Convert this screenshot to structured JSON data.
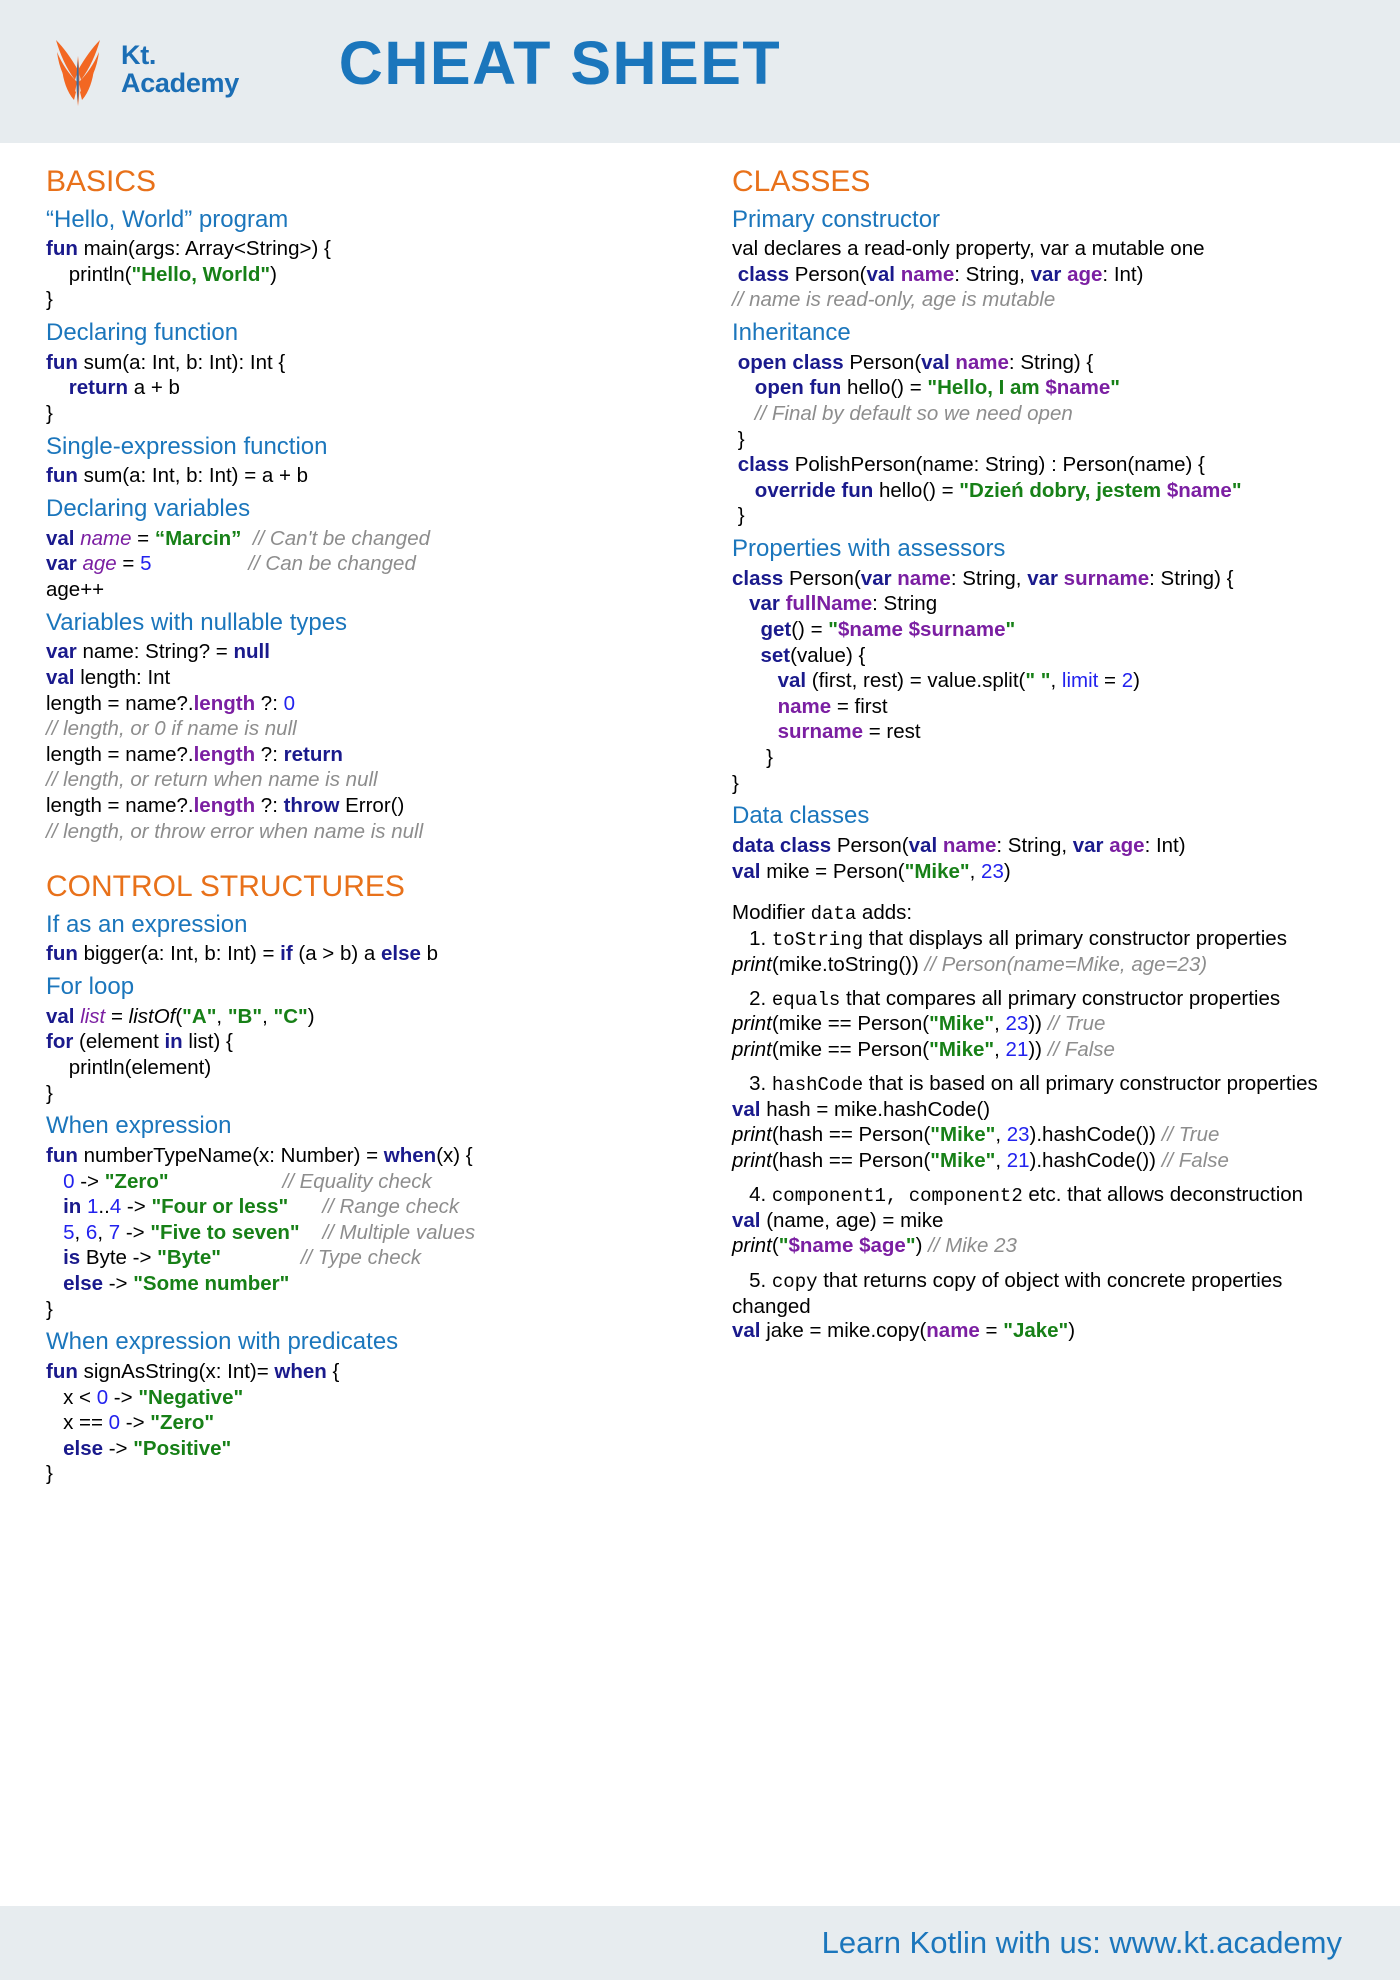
{
  "header": {
    "brand_line1": "Kt.",
    "brand_line2": "Academy",
    "title": "CHEAT SHEET",
    "logo_icon": "phoenix-logo"
  },
  "footer": {
    "text": "Learn Kotlin with us: www.kt.academy"
  },
  "colors": {
    "header_bg": "#e7ecef",
    "section_heading": "#e8711a",
    "sub_heading": "#1b76bc",
    "keyword": "#1a1a8c",
    "string": "#178017",
    "number": "#2222ee",
    "comment": "#8d8d8d",
    "property": "#7b1fa2",
    "brand_blue": "#1b6eb5"
  },
  "left_column": {
    "sections": [
      {
        "title": "BASICS",
        "blocks": [
          {
            "subtitle": "“Hello, World” program",
            "lines": [
              "fun main(args: Array<String>) {",
              "    println(\"Hello, World\")",
              "}"
            ]
          },
          {
            "subtitle": "Declaring function",
            "lines": [
              "fun sum(a: Int, b: Int): Int {",
              "    return a + b",
              "}"
            ]
          },
          {
            "subtitle": "Single-expression function",
            "lines": [
              "fun sum(a: Int, b: Int) = a + b"
            ]
          },
          {
            "subtitle": "Declaring variables",
            "lines": [
              "val name = “Marcin”   // Can't be changed",
              "var age = 5                    // Can be changed",
              "age++"
            ]
          },
          {
            "subtitle": "Variables with nullable types",
            "lines": [
              "var name: String? = null",
              "val length: Int",
              "length = name?.length ?: 0",
              "// length, or 0 if name is null",
              "length = name?.length ?: return",
              "// length, or return when name is null",
              "length = name?.length ?: throw Error()",
              "// length, or throw error when name is null"
            ]
          }
        ]
      },
      {
        "title": "CONTROL STRUCTURES",
        "blocks": [
          {
            "subtitle": "If as an expression",
            "lines": [
              "fun bigger(a: Int, b: Int) = if (a > b) a else b"
            ]
          },
          {
            "subtitle": "For loop",
            "lines": [
              "val list = listOf(\"A\", \"B\", \"C\")",
              "for (element in list) {",
              "    println(element)",
              "}"
            ]
          },
          {
            "subtitle": "When expression",
            "lines": [
              "fun numberTypeName(x: Number) = when(x) {",
              "   0 -> \"Zero\"                    // Equality check",
              "   in 1..4 -> \"Four or less\"      // Range check",
              "   5, 6, 7 -> \"Five to seven\"     // Multiple values",
              "   is Byte -> \"Byte\"              // Type check",
              "   else -> \"Some number\"",
              "}"
            ]
          },
          {
            "subtitle": "When expression with predicates",
            "lines": [
              "fun signAsString(x: Int)= when {",
              "   x < 0 -> \"Negative\"",
              "   x == 0 -> \"Zero\"",
              "   else -> \"Positive\"",
              "}"
            ]
          }
        ]
      }
    ]
  },
  "right_column": {
    "sections": [
      {
        "title": "CLASSES",
        "blocks": [
          {
            "subtitle": "Primary constructor",
            "lines": [
              "val declares a read-only property, var a mutable one",
              "class Person(val name: String, var age: Int)",
              "// name is read-only, age is mutable"
            ]
          },
          {
            "subtitle": "Inheritance",
            "lines": [
              "open class Person(val name: String) {",
              "    open fun hello() = \"Hello, I am $name\"",
              "    // Final by default so we need open",
              "}",
              "class PolishPerson(name: String) : Person(name) {",
              "    override fun hello() = \"Dzień dobry, jestem $name\"",
              "}"
            ]
          },
          {
            "subtitle": "Properties with assessors",
            "lines": [
              "class Person(var name: String, var surname: String) {",
              "    var fullName: String",
              "      get() = \"$name $surname\"",
              "      set(value) {",
              "         val (first, rest) = value.split(\" \", limit = 2)",
              "         name = first",
              "         surname = rest",
              "      }",
              "}"
            ]
          },
          {
            "subtitle": "Data classes",
            "lines": [
              "data class Person(val name: String, var age: Int)",
              "val mike = Person(\"Mike\", 23)"
            ]
          }
        ]
      }
    ],
    "modifier_intro": "Modifier data adds:",
    "modifier_keyword": "data",
    "modifier_items": [
      {
        "number": "1.",
        "mono": "toString",
        "text": " that displays all primary constructor properties",
        "examples": [
          "print(mike.toString()) // Person(name=Mike, age=23)"
        ]
      },
      {
        "number": "2.",
        "mono": "equals",
        "text": " that compares all primary constructor properties",
        "examples": [
          "print(mike == Person(\"Mike\", 23)) // True",
          "print(mike == Person(\"Mike\", 21)) // False"
        ]
      },
      {
        "number": "3.",
        "mono": "hashCode",
        "text": " that is based on all primary constructor properties",
        "examples": [
          "val hash = mike.hashCode()",
          "print(hash == Person(\"Mike\", 23).hashCode()) // True",
          "print(hash == Person(\"Mike\", 21).hashCode()) // False"
        ]
      },
      {
        "number": "4.",
        "mono": "component1, component2",
        "text": " etc. that allows deconstruction",
        "examples": [
          "val (name, age) = mike",
          "print(\"$name $age\") // Mike 23"
        ]
      },
      {
        "number": "5.",
        "mono": "copy",
        "text": " that returns copy of object with concrete properties changed",
        "examples": [
          "val jake = mike.copy(name = \"Jake\")"
        ]
      }
    ]
  }
}
